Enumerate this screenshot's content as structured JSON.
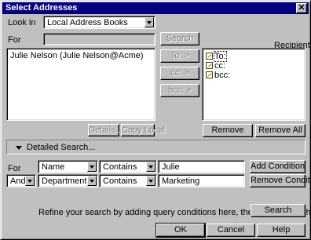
{
  "window": {
    "title": "Select Addresses",
    "close_glyph": "✕"
  },
  "look_in": {
    "label": "Look in",
    "value": "Local Address Books"
  },
  "for_search": {
    "label": "For",
    "value": "",
    "search_button": "Search"
  },
  "results": {
    "items": [
      "Julie Nelson (Julie Nelson@Acme)"
    ],
    "details_button": "Details...",
    "copy_local_button": "Copy Local"
  },
  "transfer": {
    "to_button": "To: >",
    "cc_button": "cc: >",
    "bcc_button": "bcc: >"
  },
  "recipients": {
    "label": "Recipients",
    "rows": [
      {
        "label": "To:"
      },
      {
        "label": "cc:"
      },
      {
        "label": "bcc:"
      }
    ],
    "remove_button": "Remove",
    "remove_all_button": "Remove All"
  },
  "detailed_search": {
    "toggle_label": "Detailed Search...",
    "conditions": [
      {
        "connector": "For",
        "field": "Name",
        "operator": "Contains",
        "value": "Julie"
      },
      {
        "connector": "And",
        "field": "Department",
        "operator": "Contains",
        "value": "Marketing"
      }
    ],
    "add_condition_button": "Add Condition",
    "remove_condition_button": "Remove Conditon",
    "hint": "Refine your search by adding query conditions here, then press Search.",
    "search_button": "Search"
  },
  "footer": {
    "ok_button": "OK",
    "cancel_button": "Cancel",
    "help_button": "Help"
  }
}
